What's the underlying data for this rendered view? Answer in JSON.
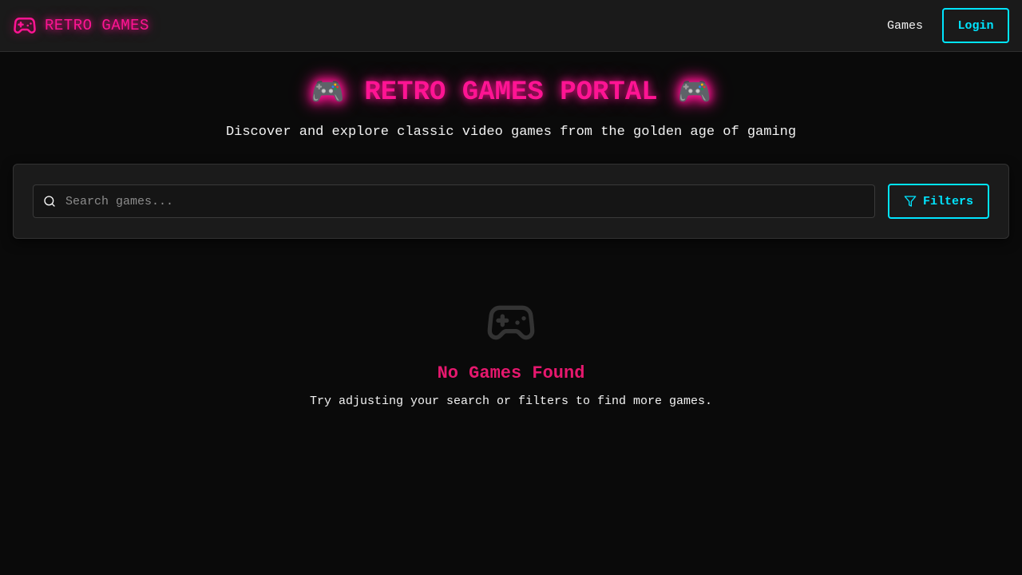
{
  "nav": {
    "brand": "RETRO GAMES",
    "links": [
      {
        "label": "Games"
      }
    ],
    "login_label": "Login"
  },
  "hero": {
    "title": "RETRO GAMES PORTAL",
    "emoji": "🎮",
    "subtitle": "Discover and explore classic video games from the golden age of gaming"
  },
  "search": {
    "placeholder": "Search games...",
    "value": "",
    "filters_label": "Filters"
  },
  "empty_state": {
    "icon": "gamepad-icon",
    "title": "No Games Found",
    "message": "Try adjusting your search or filters to find more games."
  },
  "colors": {
    "accent_pink": "#ff1493",
    "accent_cyan": "#00e5ff",
    "background": "#0a0a0a",
    "panel": "#1b1b1b"
  }
}
